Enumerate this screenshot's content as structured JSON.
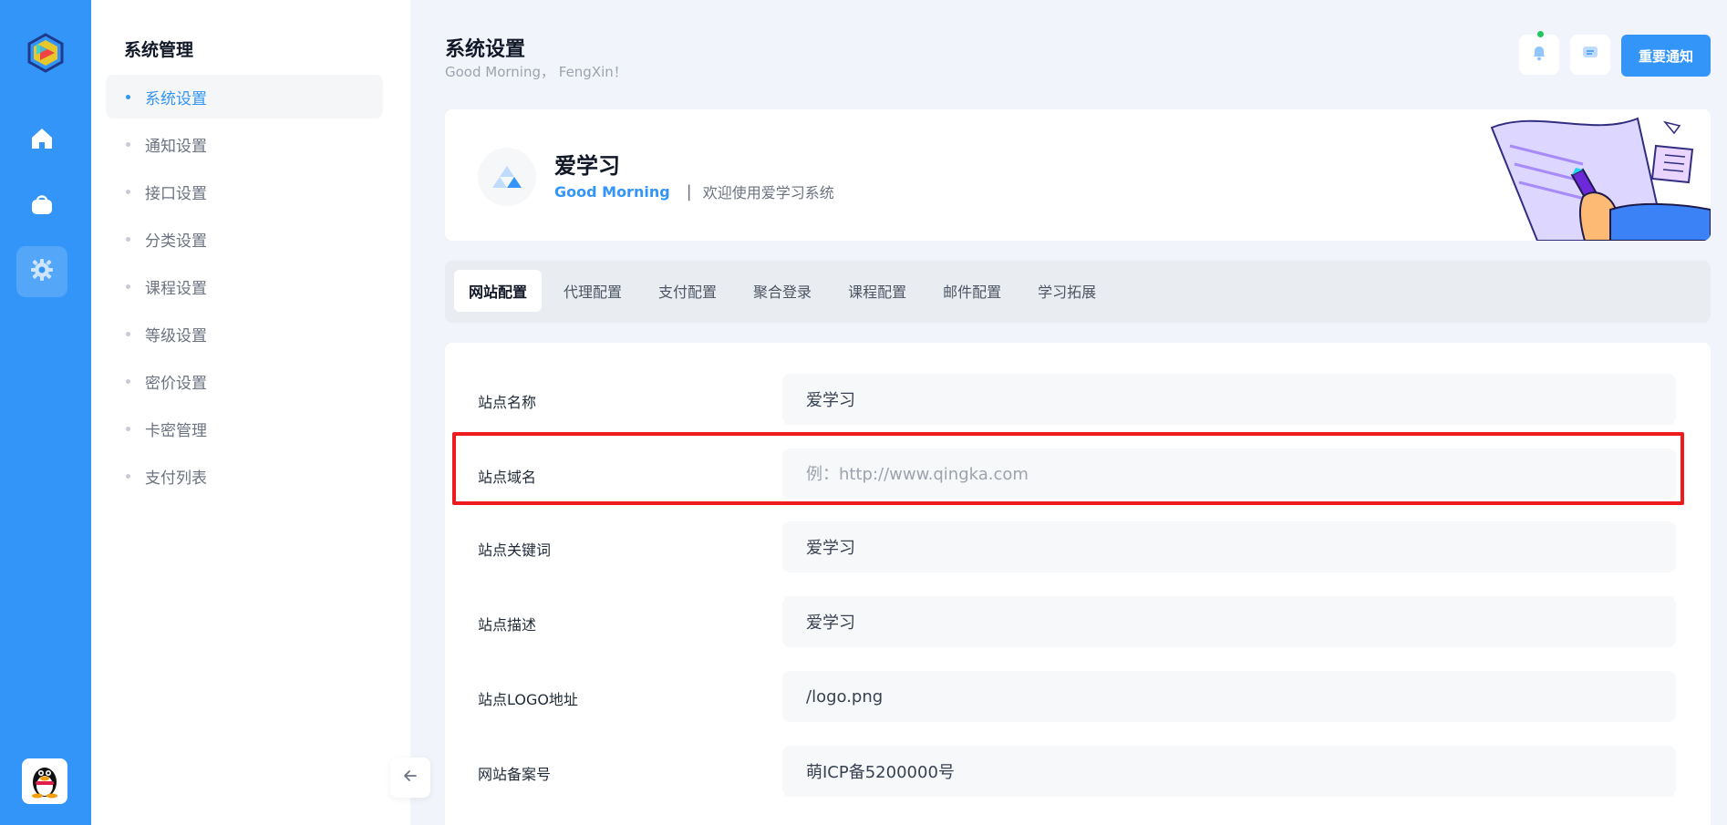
{
  "sidebar": {
    "title": "系统管理",
    "items": [
      {
        "label": "系统设置",
        "active": true
      },
      {
        "label": "通知设置"
      },
      {
        "label": "接口设置"
      },
      {
        "label": "分类设置"
      },
      {
        "label": "课程设置"
      },
      {
        "label": "等级设置"
      },
      {
        "label": "密价设置"
      },
      {
        "label": "卡密管理"
      },
      {
        "label": "支付列表"
      }
    ]
  },
  "rail": {
    "icons": [
      "app-logo-icon",
      "home-icon",
      "bag-icon",
      "gear-icon",
      "qq-penguin-icon"
    ]
  },
  "header": {
    "title": "系统设置",
    "greeting": "Good Morning， FengXin！",
    "notice_button": "重要通知",
    "icons": [
      "bell-icon",
      "message-icon"
    ]
  },
  "banner": {
    "site_name": "爱学习",
    "greeting": "Good Morning",
    "separator": "|",
    "welcome": "欢迎使用爱学习系统"
  },
  "tabs": [
    {
      "label": "网站配置",
      "active": true
    },
    {
      "label": "代理配置"
    },
    {
      "label": "支付配置"
    },
    {
      "label": "聚合登录"
    },
    {
      "label": "课程配置"
    },
    {
      "label": "邮件配置"
    },
    {
      "label": "学习拓展"
    }
  ],
  "form": {
    "fields": [
      {
        "label": "站点名称",
        "value": "爱学习",
        "placeholder": ""
      },
      {
        "label": "站点域名",
        "value": "",
        "placeholder": "例：http://www.qingka.com"
      },
      {
        "label": "站点关键词",
        "value": "爱学习",
        "placeholder": ""
      },
      {
        "label": "站点描述",
        "value": "爱学习",
        "placeholder": ""
      },
      {
        "label": "站点LOGO地址",
        "value": "/logo.png",
        "placeholder": ""
      },
      {
        "label": "网站备案号",
        "value": "萌ICP备5200000号",
        "placeholder": ""
      }
    ]
  },
  "colors": {
    "primary": "#3395f7",
    "highlight": "#ee1c1c",
    "background": "#f1f5fb"
  }
}
